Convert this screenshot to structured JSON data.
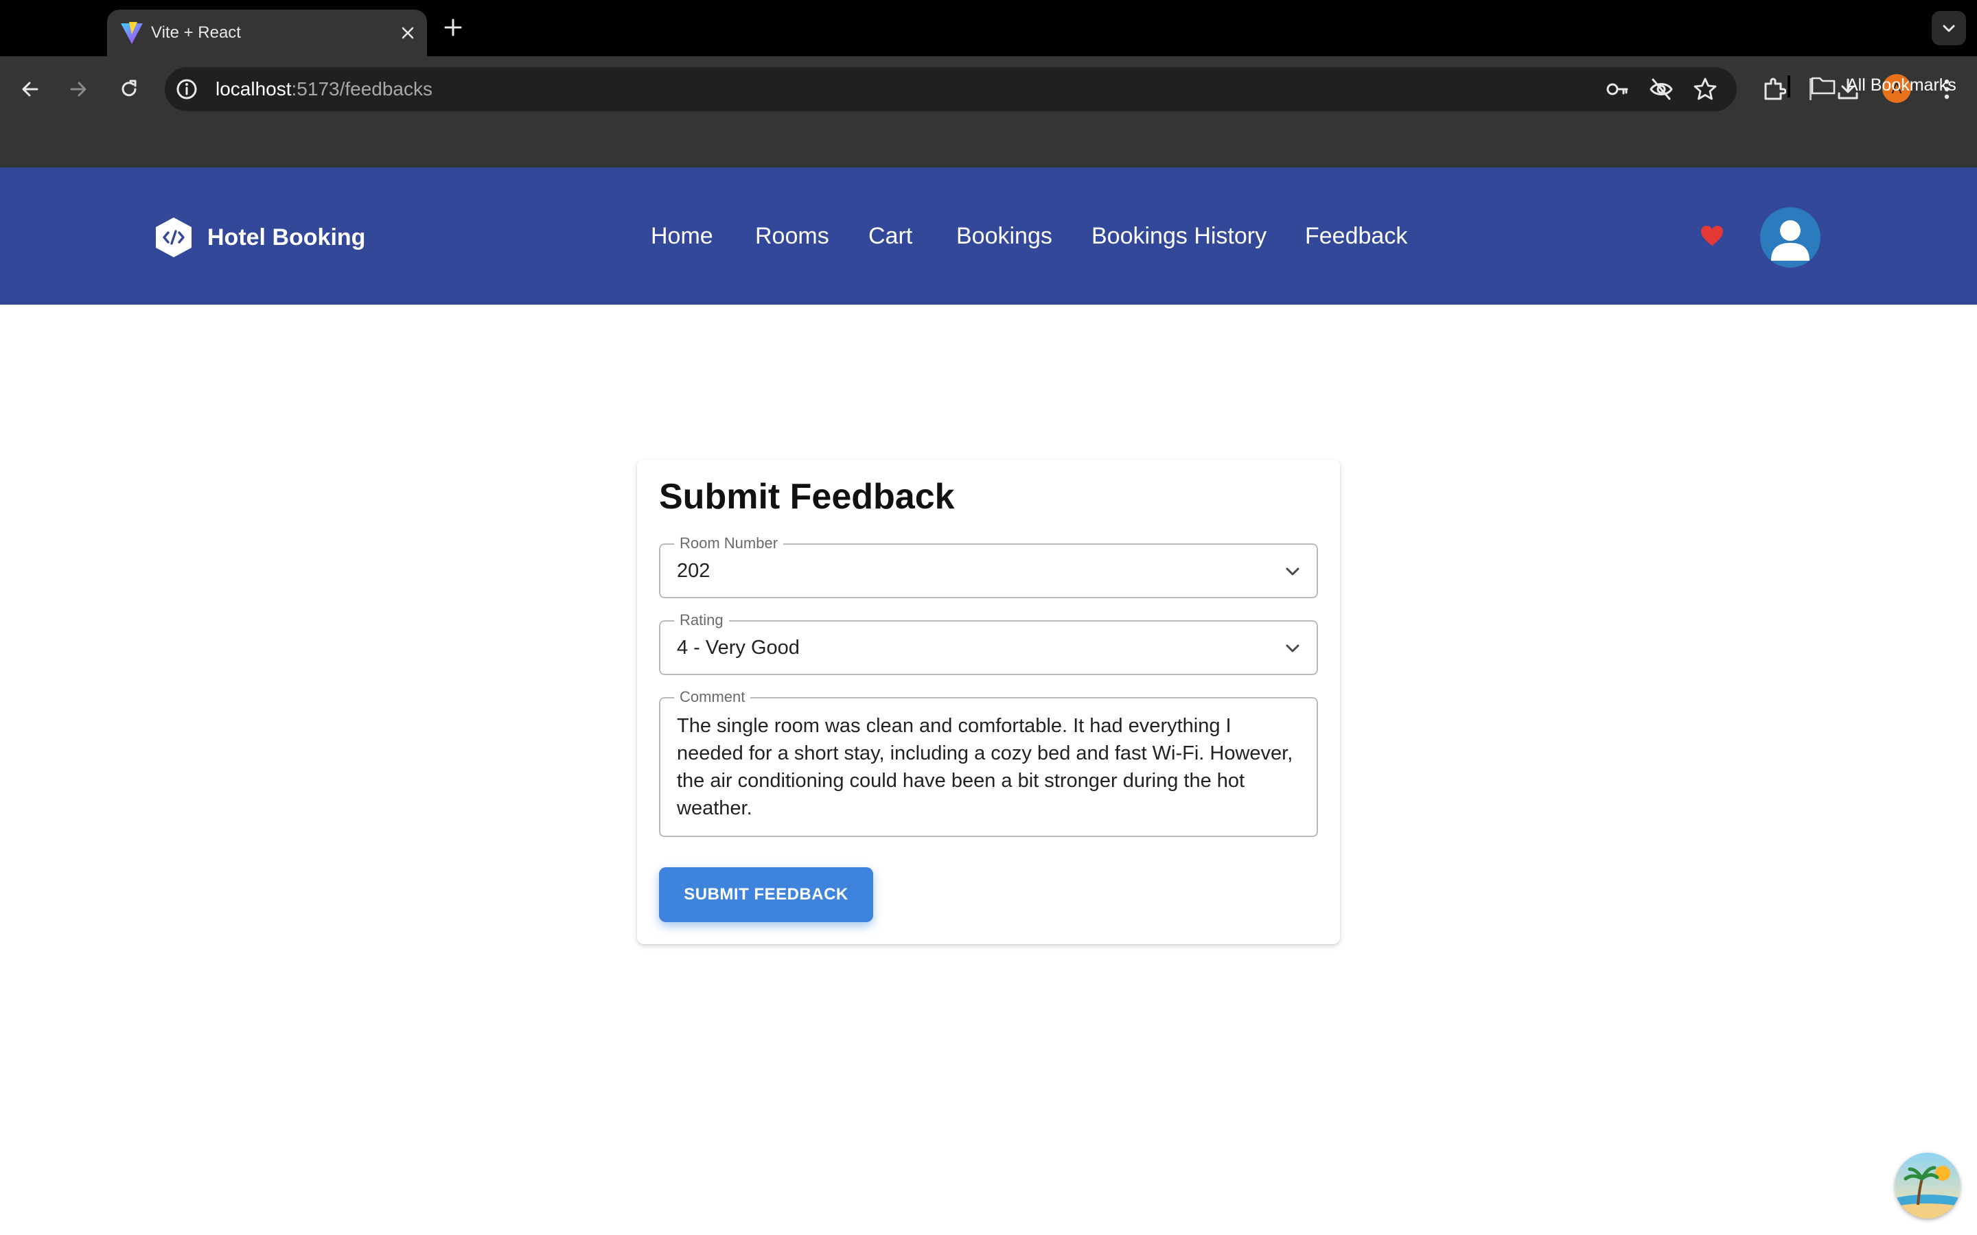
{
  "browser": {
    "tab_title": "Vite + React",
    "url_host": "localhost",
    "url_path": ":5173/feedbacks",
    "bookmarks_label": "All Bookmarks",
    "profile_initial": "A",
    "profile_color": "#e8711c"
  },
  "header": {
    "brand_name": "Hotel Booking",
    "background_color": "#34489a",
    "nav": [
      {
        "label": "Home"
      },
      {
        "label": "Rooms"
      },
      {
        "label": "Cart"
      },
      {
        "label": "Bookings"
      },
      {
        "label": "Bookings History"
      },
      {
        "label": "Feedback"
      }
    ],
    "heart_color": "#e53935"
  },
  "form": {
    "title": "Submit Feedback",
    "room_number": {
      "label": "Room Number",
      "value": "202"
    },
    "rating": {
      "label": "Rating",
      "value": "4 - Very Good"
    },
    "comment": {
      "label": "Comment",
      "value": "The single room was clean and comfortable. It had everything I needed for a short stay, including a cozy bed and fast Wi-Fi. However, the air conditioning could have been a bit stronger during the hot weather."
    },
    "submit_label": "SUBMIT FEEDBACK",
    "accent_color": "#3f84dc"
  }
}
